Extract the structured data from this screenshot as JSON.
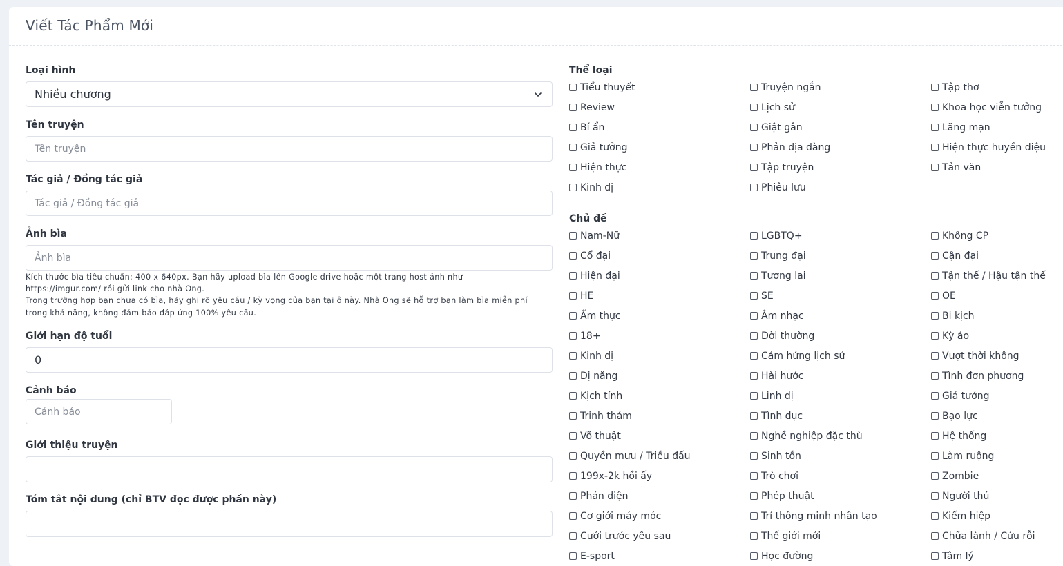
{
  "page": {
    "title": "Viết Tác Phẩm Mới"
  },
  "form": {
    "type": {
      "label": "Loại hình",
      "value": "Nhiều chương"
    },
    "story_name": {
      "label": "Tên truyện",
      "placeholder": "Tên truyện"
    },
    "author": {
      "label": "Tác giả / Đồng tác giả",
      "placeholder": "Tác giả / Đồng tác giả"
    },
    "cover": {
      "label": "Ảnh bìa",
      "placeholder": "Ảnh bìa",
      "help": [
        "Kích thước bìa tiêu chuẩn: 400 x 640px. Bạn hãy upload bìa lên Google drive hoặc một trang host ảnh như",
        "https://imgur.com/ rồi gửi link cho nhà Ong.",
        "Trong trường hợp bạn chưa có bìa, hãy ghi rõ yêu cầu / kỳ vọng của bạn tại ô này. Nhà Ong sẽ hỗ trợ bạn làm bìa miễn phí",
        "trong khả năng, không đảm bảo đáp ứng 100% yêu cầu."
      ]
    },
    "age_limit": {
      "label": "Giới hạn độ tuổi",
      "value": "0"
    },
    "warning": {
      "label": "Cảnh báo",
      "placeholder": "Cảnh báo"
    },
    "intro": {
      "label": "Giới thiệu truyện"
    },
    "summary": {
      "label": "Tóm tắt nội dung (chỉ BTV đọc được phần này)"
    }
  },
  "genres": {
    "title": "Thể loại",
    "items": [
      "Tiểu thuyết",
      "Truyện ngắn",
      "Tập thơ",
      "Review",
      "Lịch sử",
      "Khoa học viễn tưởng",
      "Bí ẩn",
      "Giật gân",
      "Lãng mạn",
      "Giả tưởng",
      "Phản địa đàng",
      "Hiện thực huyền diệu",
      "Hiện thực",
      "Tập truyện",
      "Tản văn",
      "Kinh dị",
      "Phiêu lưu"
    ]
  },
  "topics": {
    "title": "Chủ đề",
    "items": [
      "Nam-Nữ",
      "LGBTQ+",
      "Không CP",
      "Cổ đại",
      "Trung đại",
      "Cận đại",
      "Hiện đại",
      "Tương lai",
      "Tận thế / Hậu tận thế",
      "HE",
      "SE",
      "OE",
      "Ẩm thực",
      "Âm nhạc",
      "Bi kịch",
      "18+",
      "Đời thường",
      "Kỳ ảo",
      "Kinh dị",
      "Cảm hứng lịch sử",
      "Vượt thời không",
      "Dị năng",
      "Hài hước",
      "Tình đơn phương",
      "Kịch tính",
      "Linh dị",
      "Giả tưởng",
      "Trinh thám",
      "Tình dục",
      "Bạo lực",
      "Võ thuật",
      "Nghề nghiệp đặc thù",
      "Hệ thống",
      "Quyền mưu / Triều đấu",
      "Sinh tồn",
      "Làm ruộng",
      "199x-2k hồi ấy",
      "Trò chơi",
      "Zombie",
      "Phản diện",
      "Phép thuật",
      "Người thú",
      "Cơ giới máy móc",
      "Trí thông minh nhân tạo",
      "Kiếm hiệp",
      "Cưới trước yêu sau",
      "Thế giới mới",
      "Chữa lành / Cứu rỗi",
      "E-sport",
      "Học đường",
      "Tâm lý"
    ]
  }
}
